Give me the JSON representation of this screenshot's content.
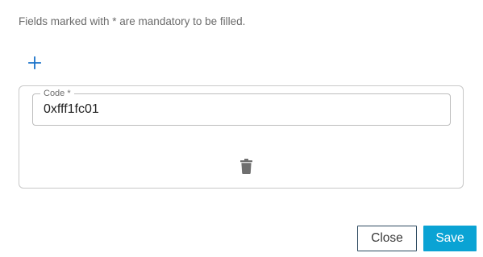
{
  "form": {
    "mandatory_notice": "Fields marked with * are mandatory to be filled."
  },
  "add_button": {
    "icon": "plus-icon",
    "color": "#1a73c9"
  },
  "entries": [
    {
      "code_label": "Code *",
      "code_value": "0xfff1fc01",
      "delete_icon": "trash-icon"
    }
  ],
  "actions": {
    "close_label": "Close",
    "save_label": "Save"
  },
  "colors": {
    "accent": "#0aa3d4",
    "close_border": "#2d4a60",
    "icon_gray": "#6f6f6f"
  }
}
